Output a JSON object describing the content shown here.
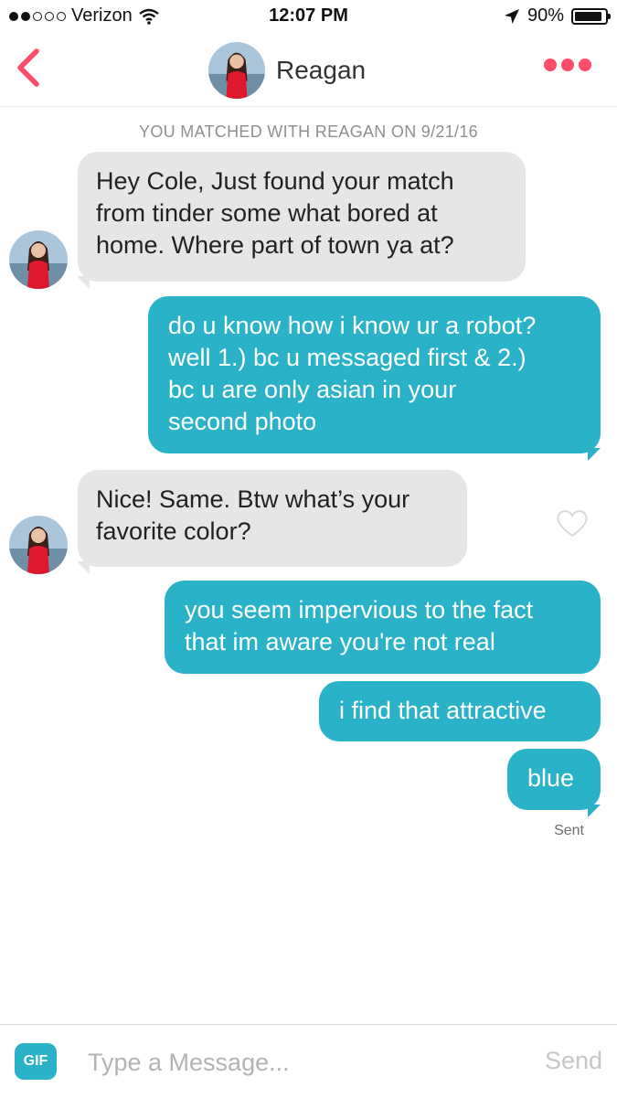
{
  "status_bar": {
    "carrier": "Verizon",
    "time": "12:07 PM",
    "battery_percent": "90%",
    "battery_level": 0.9,
    "signal_bars_filled": 2,
    "signal_bars_total": 5
  },
  "header": {
    "contact_name": "Reagan",
    "accent_color": "#fd4c6b"
  },
  "match_notice": "YOU MATCHED WITH REAGAN ON 9/21/16",
  "messages": [
    {
      "from": "them",
      "text": "Hey Cole,  Just found your match\nfrom tinder some what bored at\nhome. Where part of town ya at?"
    },
    {
      "from": "me",
      "text": "do u know how i know ur a robot?\nwell 1.) bc u messaged first & 2.)\nbc u are only asian in your\nsecond photo"
    },
    {
      "from": "them",
      "text": "Nice! Same. Btw what’s your\nfavorite color?"
    },
    {
      "from": "me",
      "text": "you seem impervious to the fact\nthat im aware you're not real"
    },
    {
      "from": "me",
      "text": "i find that attractive"
    },
    {
      "from": "me",
      "text": "blue"
    }
  ],
  "sent_label": "Sent",
  "composer": {
    "gif_label": "GIF",
    "placeholder": "Type a Message...",
    "value": "",
    "send_label": "Send"
  },
  "colors": {
    "outgoing_bubble": "#2ab2c8",
    "incoming_bubble": "#e6e6e6"
  },
  "icons": [
    "back-chevron-icon",
    "more-dots-icon",
    "heart-outline-icon",
    "location-arrow-icon",
    "wifi-icon"
  ]
}
